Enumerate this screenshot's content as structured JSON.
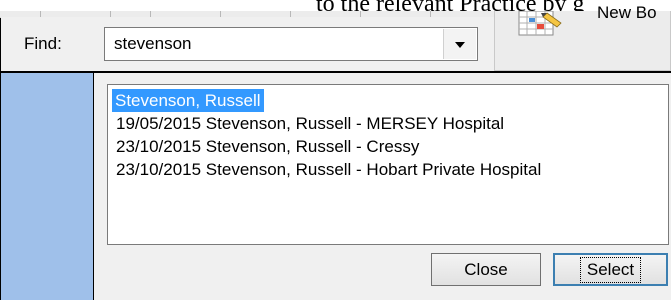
{
  "caption": {
    "text": "to the relevant Practice by g"
  },
  "find": {
    "label": "Find:",
    "value": "stevenson"
  },
  "toolbar": {
    "new_booking_label": "New Bo"
  },
  "results": {
    "items": [
      {
        "label": "Stevenson, Russell",
        "selected": true
      },
      {
        "label": "19/05/2015 Stevenson, Russell - MERSEY Hospital",
        "selected": false
      },
      {
        "label": "23/10/2015 Stevenson, Russell - Cressy",
        "selected": false
      },
      {
        "label": "23/10/2015 Stevenson, Russell - Hobart Private Hospital",
        "selected": false
      }
    ]
  },
  "actions": {
    "close_label": "Close",
    "select_label": "Select"
  },
  "colors": {
    "selection": "#3399ff",
    "side_panel": "#9fc0ea"
  },
  "icons": {
    "dropdown": "chevron-down-icon",
    "new_booking": "calendar-pen-icon"
  }
}
